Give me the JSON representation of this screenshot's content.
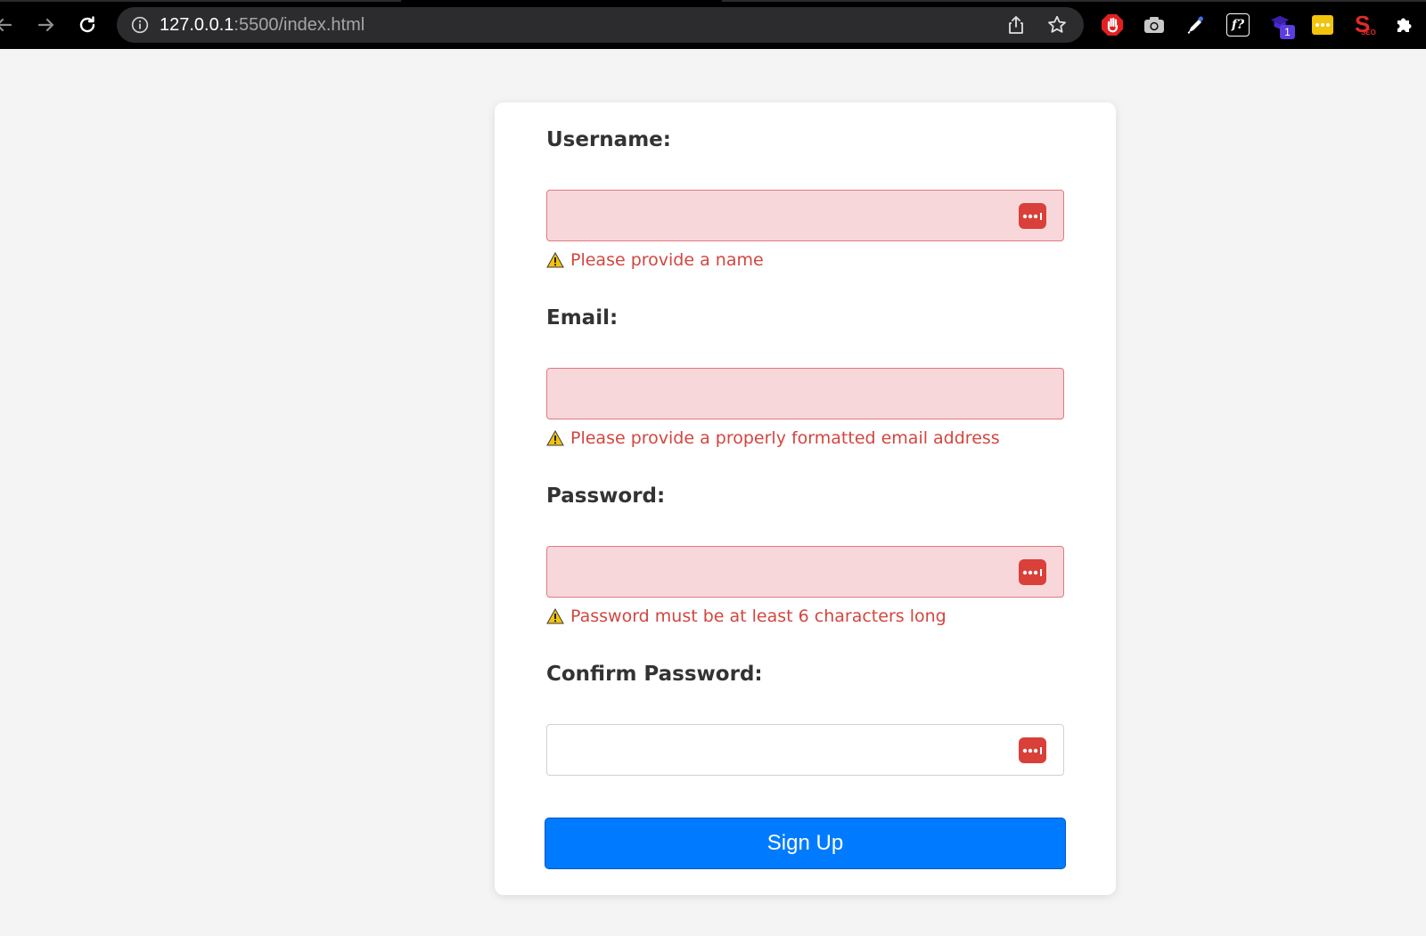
{
  "browser": {
    "url_host": "127.0.0.1",
    "url_path": ":5500/index.html",
    "extensions": [
      {
        "icon": "adblock-hand-icon"
      },
      {
        "icon": "camera-icon"
      },
      {
        "icon": "eyedropper-icon"
      },
      {
        "icon": "whatfont-icon",
        "text": "f?"
      },
      {
        "icon": "extension-badge-icon",
        "badge": "1"
      },
      {
        "icon": "password-dots-icon"
      },
      {
        "icon": "seo-icon",
        "text": "S",
        "subtext": "SEO"
      },
      {
        "icon": "puzzle-icon"
      }
    ]
  },
  "form": {
    "username": {
      "label": "Username:",
      "value": "",
      "error": "Please provide a name"
    },
    "email": {
      "label": "Email:",
      "value": "",
      "error": "Please provide a properly formatted email address"
    },
    "password": {
      "label": "Password:",
      "value": "",
      "error": "Password must be at least 6 characters long"
    },
    "confirm_password": {
      "label": "Confirm Password:",
      "value": ""
    },
    "submit_label": "Sign Up"
  },
  "colors": {
    "error_text": "#d2463f",
    "error_bg": "#f8d7da",
    "error_border": "#e0797f",
    "primary": "#007bff",
    "page_bg": "#f4f4f4"
  }
}
